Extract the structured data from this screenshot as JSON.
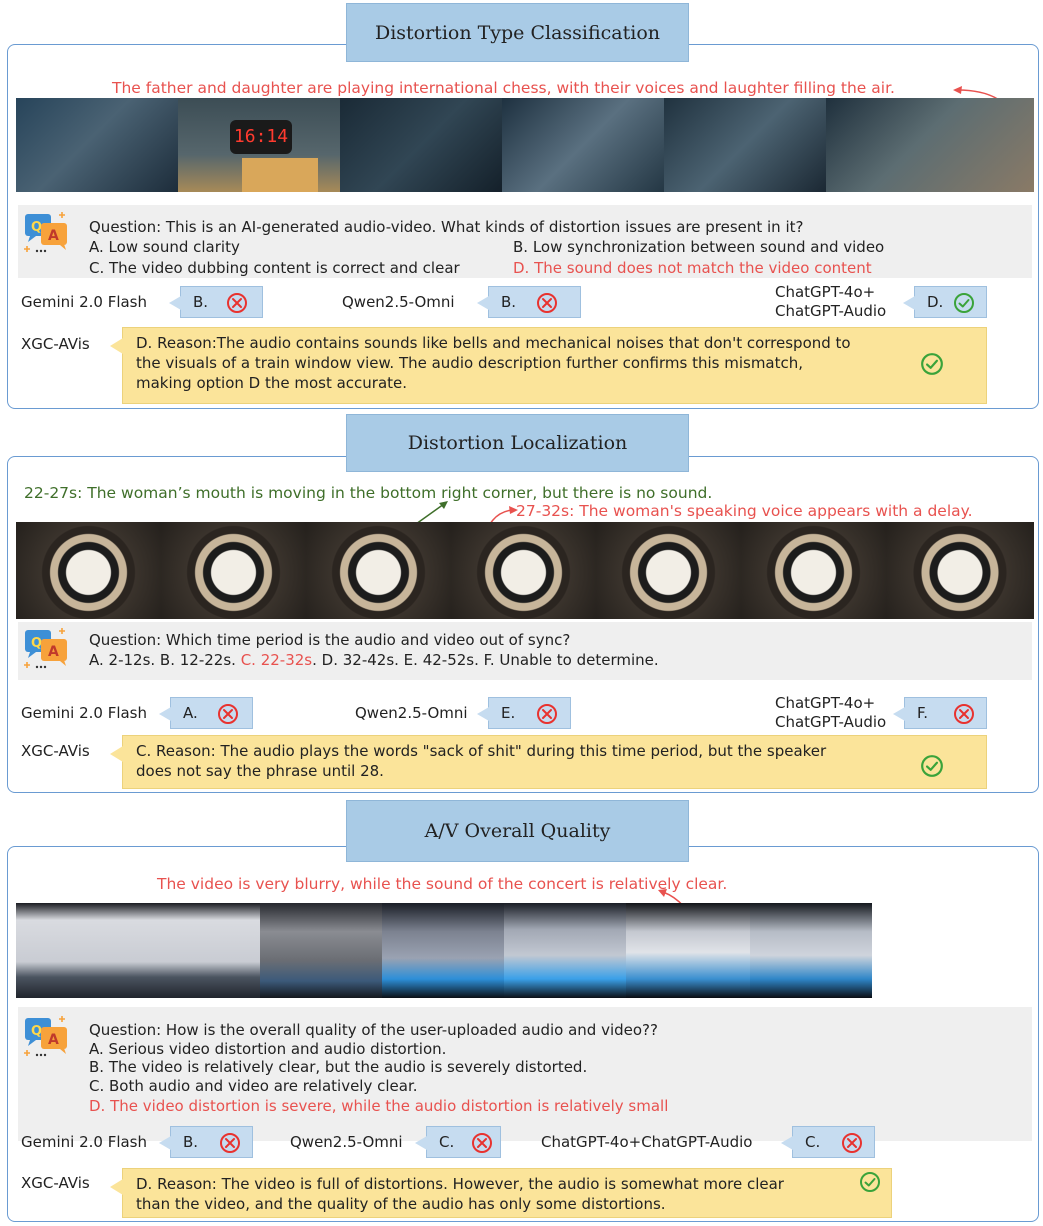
{
  "sections": [
    {
      "title": "Distortion Type Classification",
      "captions": [
        "The father and daughter are playing international chess, with their voices and laughter filling the air."
      ],
      "question": "Question: This is an AI-generated audio-video. What kinds of distortion issues are present in it?",
      "options": [
        "A.  Low sound clarity",
        "B. Low synchronization between sound and video",
        "C. The video dubbing content is correct and clear",
        "D. The sound does not match the video content"
      ],
      "answers": [
        {
          "model": "Gemini 2.0 Flash",
          "answer": "B.",
          "correct": false
        },
        {
          "model": "Qwen2.5-Omni",
          "answer": "B.",
          "correct": false
        },
        {
          "model": "ChatGPT-4o+\nChatGPT-Audio",
          "answer": "D.",
          "correct": true
        }
      ],
      "ours": {
        "model": "XGC-AVis",
        "reason_lines": [
          "D. Reason:The audio contains sounds like bells and mechanical noises that don't correspond to",
          "the visuals of a train window view. The audio description further confirms this mismatch,",
          "making option D the most accurate."
        ],
        "correct": true
      }
    },
    {
      "title": "Distortion Localization",
      "captions": [
        "22-27s: The woman’s mouth is moving in the bottom right corner, but there is no sound.",
        "27-32s: The woman's speaking voice appears with a delay."
      ],
      "question": "Question: Which time period is the audio and video out of sync?",
      "options_inline": [
        "A.  2-12s. B. 12-22s. ",
        "C. 22-32s",
        ". D. 32-42s. E. 42-52s. F. Unable to determine."
      ],
      "answers": [
        {
          "model": "Gemini 2.0 Flash",
          "answer": "A.",
          "correct": false
        },
        {
          "model": "Qwen2.5-Omni",
          "answer": "E.",
          "correct": false
        },
        {
          "model": "ChatGPT-4o+\nChatGPT-Audio",
          "answer": "F.",
          "correct": false
        }
      ],
      "ours": {
        "model": "XGC-AVis",
        "reason_lines": [
          "C. Reason: The audio plays the words \"sack of shit\" during this time period, but the speaker",
          "does not say the phrase until 28."
        ],
        "correct": true
      }
    },
    {
      "title": "A/V Overall Quality",
      "captions": [
        "The video is very blurry, while the sound of the concert is relatively clear."
      ],
      "question": "Question: How is the overall quality of the user-uploaded audio and video??",
      "options": [
        "A.  Serious video distortion and audio distortion.",
        "B.  The video is relatively clear, but the audio is severely distorted.",
        "C.  Both audio and video are relatively clear.",
        "D.  The video distortion is severe, while the audio distortion is relatively small"
      ],
      "answers": [
        {
          "model": "Gemini 2.0 Flash",
          "answer": "B.",
          "correct": false
        },
        {
          "model": "Qwen2.5-Omni",
          "answer": "C.",
          "correct": false
        },
        {
          "model": "ChatGPT-4o+ChatGPT-Audio",
          "answer": "C.",
          "correct": false
        }
      ],
      "ours": {
        "model": "XGC-AVis",
        "reason_lines": [
          "D. Reason: The video is full of distortions. However, the audio is somewhat more clear",
          "than the video, and the quality of the audio has only some distortions."
        ],
        "correct": true
      }
    }
  ],
  "icons": {
    "qa": "qa-chat-icon",
    "wrong": "cross-circle-icon",
    "right": "check-circle-icon"
  },
  "colors": {
    "panel_border": "#6a9bd2",
    "title_bg": "#a9cbe6",
    "answer_bg": "#c6dcf0",
    "reason_bg": "#fbe49a",
    "highlight_red": "#e8524f",
    "caption_green": "#3f6f2a",
    "wrong": "#e8322f",
    "right": "#3aa33a"
  }
}
